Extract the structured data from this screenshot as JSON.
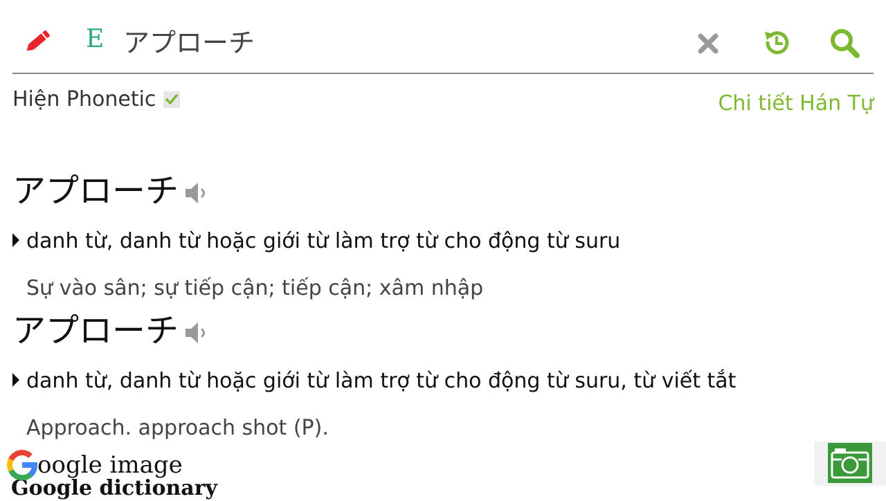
{
  "header": {
    "edit_icon": "pencil-icon",
    "language_badge": "E",
    "query": "アプローチ",
    "clear_icon": "close-icon",
    "history_icon": "history-icon",
    "search_icon": "search-icon"
  },
  "options": {
    "phonetic_label": "Hiện Phonetic",
    "phonetic_checked": true,
    "kanji_link": "Chi tiết Hán Tự"
  },
  "entries": [
    {
      "word": "アプローチ",
      "pos": "danh từ, danh từ hoặc giới từ làm trợ từ cho động từ suru",
      "meaning": "Sự vào sân; sự tiếp cận; tiếp cận; xâm nhập"
    },
    {
      "word": "アプローチ",
      "pos": "danh từ, danh từ hoặc giới từ làm trợ từ cho động từ suru, từ viết tắt",
      "meaning": "Approach. approach shot (P)."
    }
  ],
  "footer": {
    "google_image_label": "oogle image",
    "google_dictionary_label": "Google dictionary",
    "camera_icon": "camera-icon"
  },
  "colors": {
    "accent_green": "#7cb930",
    "badge_green": "#2aa87e",
    "pencil_red": "#e8262a",
    "clear_grey": "#999999"
  }
}
